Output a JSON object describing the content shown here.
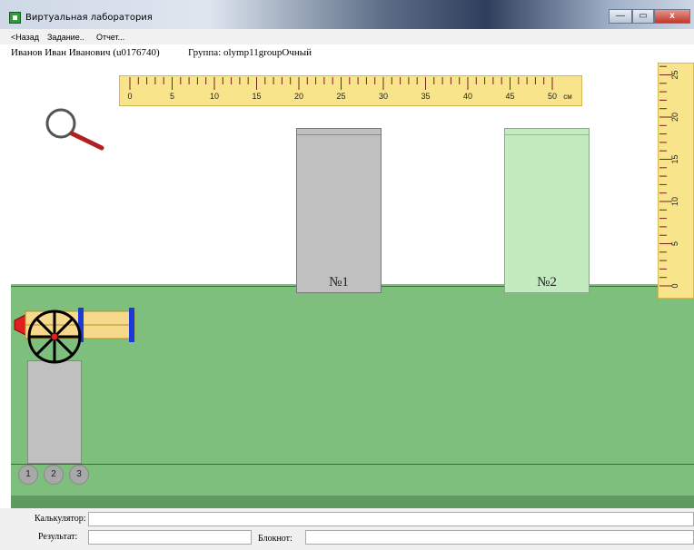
{
  "window": {
    "title": "Виртуальная лаборатория",
    "buttons": {
      "minimize": "—",
      "maximize": "▭",
      "close": "x"
    }
  },
  "menu": {
    "back": "<Назад",
    "task": "Задание..",
    "report": "Отчет..."
  },
  "user": {
    "name": "Иванов Иван Иванович (u0176740)",
    "group": "Группа: olymp11groupОчный"
  },
  "ruler_horizontal": {
    "labels": [
      "0",
      "5",
      "10",
      "15",
      "20",
      "25",
      "30",
      "35",
      "40",
      "45",
      "50"
    ],
    "unit": "см"
  },
  "ruler_vertical": {
    "labels": [
      "0",
      "5",
      "10",
      "15",
      "20",
      "25"
    ]
  },
  "beakers": [
    {
      "label": "№1",
      "color": "#c0c0c0"
    },
    {
      "label": "№2",
      "color": "#c2ebc0"
    }
  ],
  "scale_buttons": [
    "1",
    "2",
    "3"
  ],
  "bottom": {
    "calculator_label": "Калькулятор:",
    "calculator_value": "",
    "result_label": "Результат:",
    "result_value": "",
    "notepad_label": "Блокнот:",
    "notepad_value": ""
  },
  "colors": {
    "ground": "#7fbf7e",
    "cannon_barrel": "#f7d98b",
    "cannon_band": "#1a3bd6",
    "cannon_cap": "#e02020",
    "magnifier_handle": "#b02020"
  }
}
